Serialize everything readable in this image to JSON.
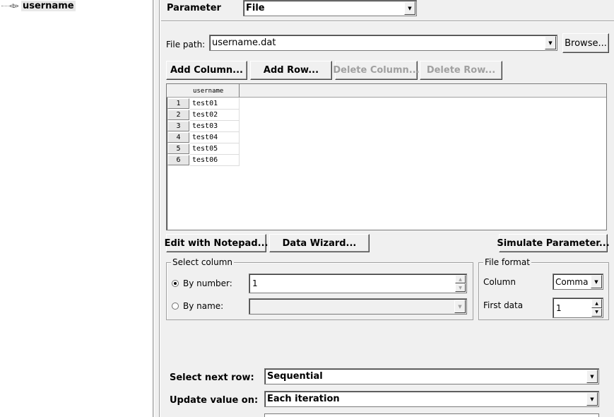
{
  "tree": {
    "node_icon": "<b>",
    "node_label": "username"
  },
  "parameter": {
    "label": "Parameter",
    "type_value": "File"
  },
  "file": {
    "path_label": "File path:",
    "path_value": "username.dat",
    "browse_label": "Browse..."
  },
  "buttons": {
    "add_column": "Add Column...",
    "add_row": "Add Row...",
    "delete_column": "Delete Column...",
    "delete_row": "Delete Row...",
    "edit_notepad": "Edit with Notepad...",
    "data_wizard": "Data Wizard...",
    "simulate": "Simulate Parameter..."
  },
  "grid": {
    "column_header": "username",
    "rows": [
      {
        "num": "1",
        "value": "test01"
      },
      {
        "num": "2",
        "value": "test02"
      },
      {
        "num": "3",
        "value": "test03"
      },
      {
        "num": "4",
        "value": "test04"
      },
      {
        "num": "5",
        "value": "test05"
      },
      {
        "num": "6",
        "value": "test06"
      }
    ]
  },
  "select_column": {
    "title": "Select column",
    "by_number_label": "By number:",
    "by_number_value": "1",
    "by_name_label": "By name:",
    "selected": "by_number"
  },
  "file_format": {
    "title": "File format",
    "column_label": "Column",
    "column_value": "Comma",
    "first_data_label": "First data",
    "first_data_value": "1"
  },
  "options": {
    "select_next_row_label": "Select next row:",
    "select_next_row_value": "Sequential",
    "update_value_label": "Update value on:",
    "update_value_value": "Each iteration"
  }
}
